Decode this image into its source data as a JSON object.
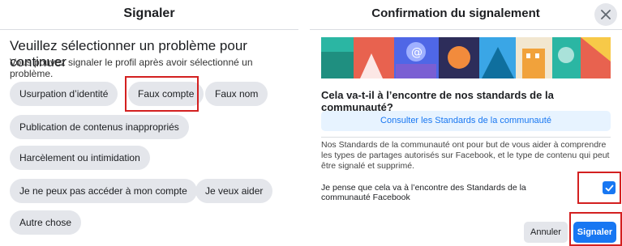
{
  "left": {
    "title": "Signaler",
    "heading": "Veuillez sélectionner un problème pour continuer",
    "subheading": "Vous pouvez signaler le profil après avoir sélectionné un problème.",
    "options": [
      "Usurpation d’identité",
      "Faux compte",
      "Faux nom",
      "Publication de contenus inappropriés",
      "Harcèlement ou intimidation",
      "Je ne peux pas accéder à mon compte",
      "Je veux aider",
      "Autre chose"
    ]
  },
  "right": {
    "title": "Confirmation du signalement",
    "close_icon": "close-icon",
    "question": "Cela va-t-il à l’encontre de nos standards de la communauté?",
    "standards_button": "Consulter les Standards de la communauté",
    "description": "Nos Standards de la communauté ont pour but de vous aider à comprendre les types de partages autorisés sur Facebook, et le type de contenu qui peut être signalé et supprimé.",
    "agree_label": "Je pense que cela va à l’encontre des Standards de la communauté Facebook",
    "agree_checked": true,
    "cancel_button": "Annuler",
    "submit_button": "Signaler"
  },
  "colors": {
    "primary": "#1877f2",
    "chip_bg": "#e4e6eb",
    "highlight": "#d32020",
    "link_bg": "#e7f3ff"
  }
}
